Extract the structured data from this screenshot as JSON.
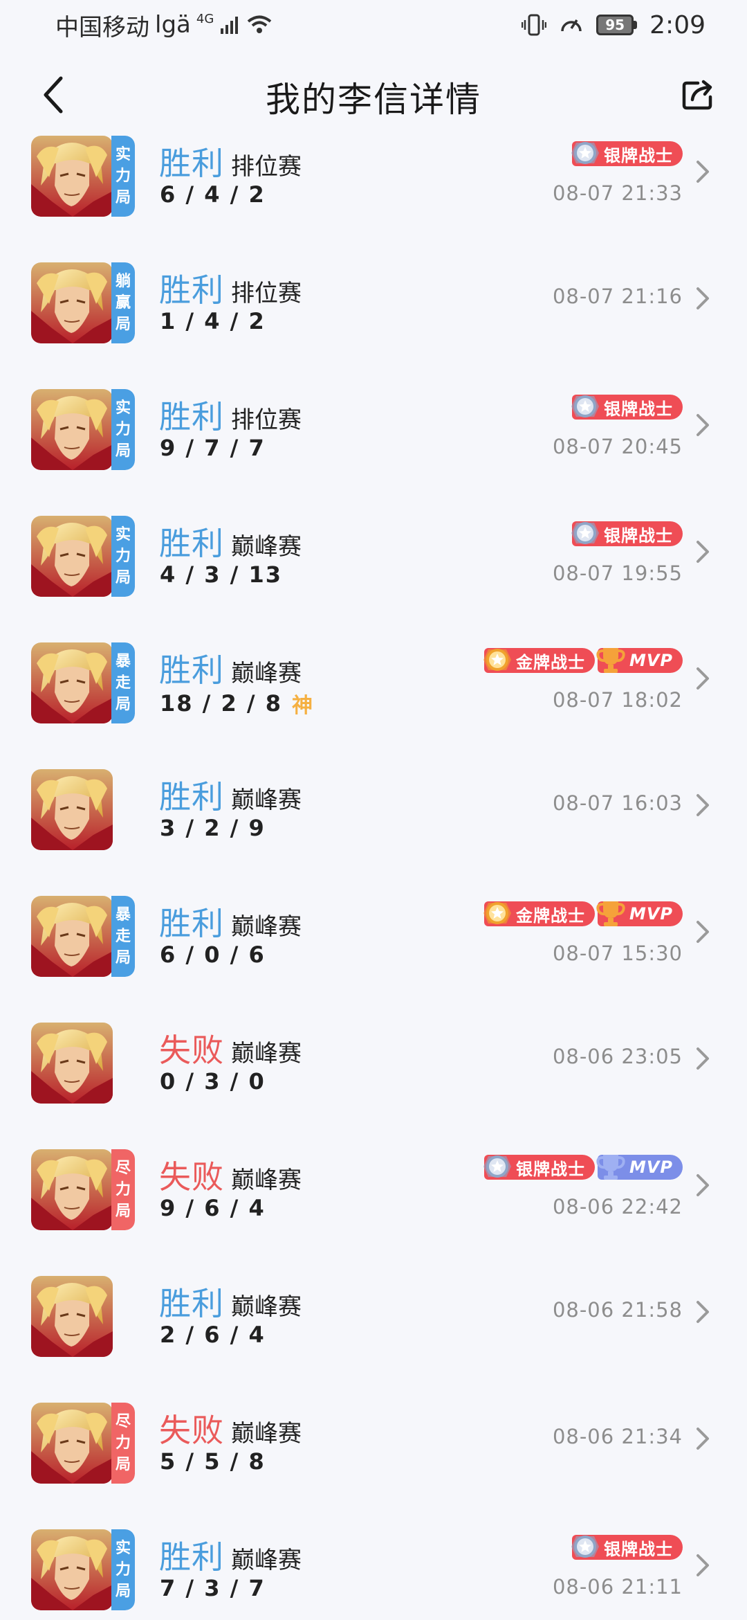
{
  "status_bar": {
    "carrier": "中国移动",
    "carrier_suffix": "lgä",
    "network": "4G",
    "battery": "95",
    "time": "2:09"
  },
  "header": {
    "title": "我的李信详情",
    "back_icon": "chevron-left-icon",
    "share_icon": "share-icon"
  },
  "colors": {
    "win": "#4a9ddd",
    "lose": "#ea5a5a",
    "tag_blue": "#4a9fe3",
    "tag_red": "#f06565",
    "badge_red": "#ef4d55",
    "badge_blue": "#7c8ee8",
    "god_gold": "#f5b042"
  },
  "matches": [
    {
      "outcome": "胜利",
      "win": true,
      "mode": "排位赛",
      "kda": "6 / 4 / 2",
      "god": "",
      "time": "08-07 21:33",
      "tag": [
        "实",
        "力",
        "局"
      ],
      "tag_color": "blue",
      "badges": [
        {
          "text": "银牌战士",
          "type": "silver"
        }
      ]
    },
    {
      "outcome": "胜利",
      "win": true,
      "mode": "排位赛",
      "kda": "1 / 4 / 2",
      "god": "",
      "time": "08-07 21:16",
      "tag": [
        "躺",
        "赢",
        "局"
      ],
      "tag_color": "blue",
      "badges": []
    },
    {
      "outcome": "胜利",
      "win": true,
      "mode": "排位赛",
      "kda": "9 / 7 / 7",
      "god": "",
      "time": "08-07 20:45",
      "tag": [
        "实",
        "力",
        "局"
      ],
      "tag_color": "blue",
      "badges": [
        {
          "text": "银牌战士",
          "type": "silver"
        }
      ]
    },
    {
      "outcome": "胜利",
      "win": true,
      "mode": "巅峰赛",
      "kda": "4 / 3 / 13",
      "god": "",
      "time": "08-07 19:55",
      "tag": [
        "实",
        "力",
        "局"
      ],
      "tag_color": "blue",
      "badges": [
        {
          "text": "银牌战士",
          "type": "silver"
        }
      ]
    },
    {
      "outcome": "胜利",
      "win": true,
      "mode": "巅峰赛",
      "kda": "18 / 2 / 8",
      "god": "神",
      "time": "08-07 18:02",
      "tag": [
        "暴",
        "走",
        "局"
      ],
      "tag_color": "blue",
      "badges": [
        {
          "text": "金牌战士",
          "type": "gold"
        },
        {
          "text": "MVP",
          "type": "mvp-red"
        }
      ]
    },
    {
      "outcome": "胜利",
      "win": true,
      "mode": "巅峰赛",
      "kda": "3 / 2 / 9",
      "god": "",
      "time": "08-07 16:03",
      "tag": [],
      "tag_color": "",
      "badges": []
    },
    {
      "outcome": "胜利",
      "win": true,
      "mode": "巅峰赛",
      "kda": "6 / 0 / 6",
      "god": "",
      "time": "08-07 15:30",
      "tag": [
        "暴",
        "走",
        "局"
      ],
      "tag_color": "blue",
      "badges": [
        {
          "text": "金牌战士",
          "type": "gold"
        },
        {
          "text": "MVP",
          "type": "mvp-red"
        }
      ]
    },
    {
      "outcome": "失败",
      "win": false,
      "mode": "巅峰赛",
      "kda": "0 / 3 / 0",
      "god": "",
      "time": "08-06 23:05",
      "tag": [],
      "tag_color": "",
      "badges": []
    },
    {
      "outcome": "失败",
      "win": false,
      "mode": "巅峰赛",
      "kda": "9 / 6 / 4",
      "god": "",
      "time": "08-06 22:42",
      "tag": [
        "尽",
        "力",
        "局"
      ],
      "tag_color": "red",
      "badges": [
        {
          "text": "银牌战士",
          "type": "silver"
        },
        {
          "text": "MVP",
          "type": "mvp-blue"
        }
      ]
    },
    {
      "outcome": "胜利",
      "win": true,
      "mode": "巅峰赛",
      "kda": "2 / 6 / 4",
      "god": "",
      "time": "08-06 21:58",
      "tag": [],
      "tag_color": "",
      "badges": []
    },
    {
      "outcome": "失败",
      "win": false,
      "mode": "巅峰赛",
      "kda": "5 / 5 / 8",
      "god": "",
      "time": "08-06 21:34",
      "tag": [
        "尽",
        "力",
        "局"
      ],
      "tag_color": "red",
      "badges": []
    },
    {
      "outcome": "胜利",
      "win": true,
      "mode": "巅峰赛",
      "kda": "7 / 3 / 7",
      "god": "",
      "time": "08-06 21:11",
      "tag": [
        "实",
        "力",
        "局"
      ],
      "tag_color": "blue",
      "badges": [
        {
          "text": "银牌战士",
          "type": "silver"
        }
      ]
    }
  ]
}
